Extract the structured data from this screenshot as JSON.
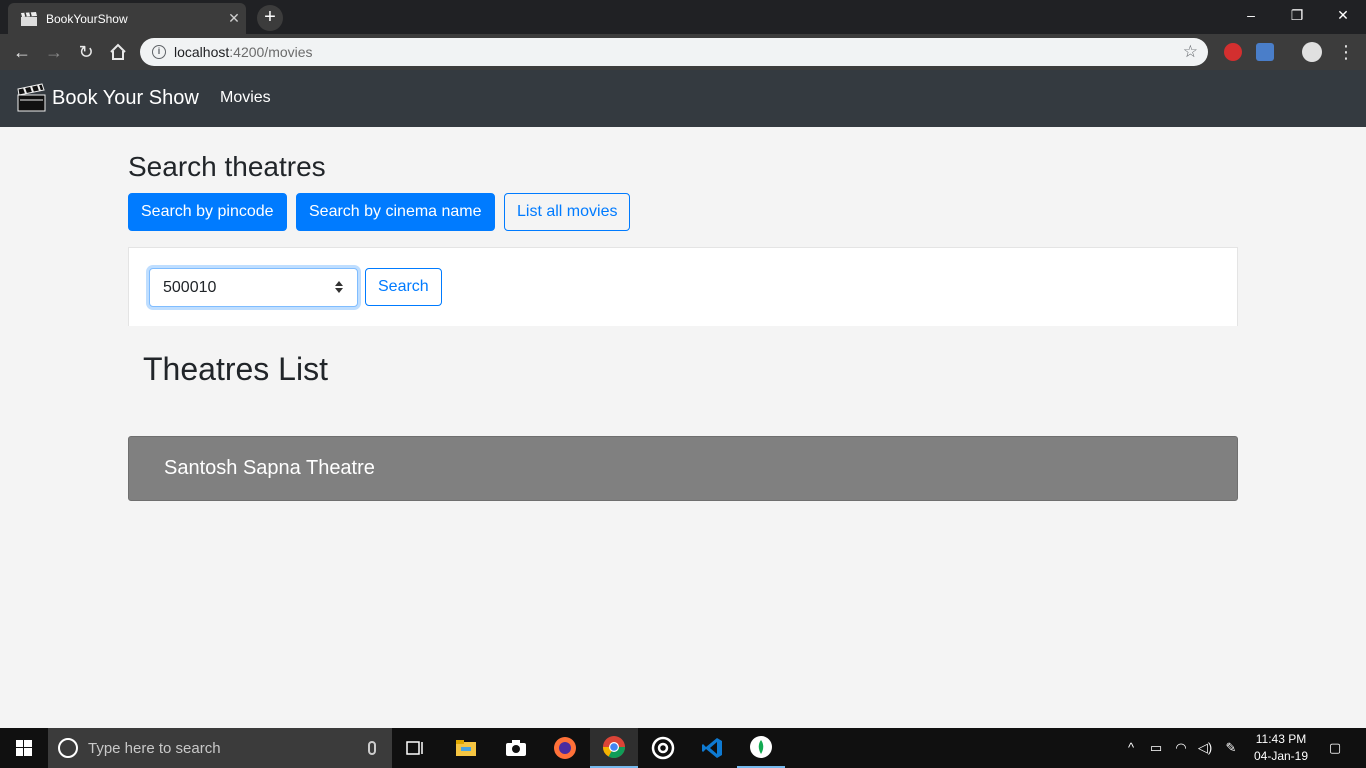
{
  "browser": {
    "tab_title": "BookYourShow",
    "tab_close": "✕",
    "new_tab": "+",
    "url_host": "localhost",
    "url_path": ":4200/movies",
    "win_minimize": "–",
    "win_restore": "❐",
    "win_close": "✕"
  },
  "navbar": {
    "brand": "Book Your Show",
    "link_movies": "Movies"
  },
  "search": {
    "heading": "Search theatres",
    "btn_pincode": "Search by pincode",
    "btn_cinema": "Search by cinema name",
    "btn_list_movies": "List all movies",
    "pincode_value": "500010",
    "search_button": "Search"
  },
  "results": {
    "heading": "Theatres List",
    "theatres": [
      {
        "name": "Santosh Sapna Theatre"
      }
    ]
  },
  "taskbar": {
    "search_placeholder": "Type here to search",
    "time": "11:43 PM",
    "date": "04-Jan-19"
  },
  "colors": {
    "primary": "#007bff",
    "navbar": "#343a40",
    "theatre_card": "#808080"
  }
}
